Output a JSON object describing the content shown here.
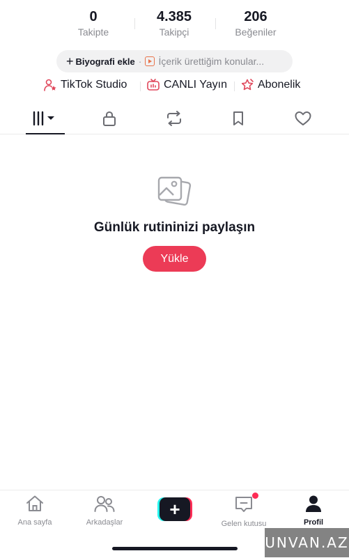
{
  "stats": [
    {
      "value": "0",
      "label": "Takipte"
    },
    {
      "value": "4.385",
      "label": "Takipçi"
    },
    {
      "value": "206",
      "label": "Beğeniler"
    }
  ],
  "bio_pill": {
    "add_label": "Biyografi ekle",
    "separator": "·",
    "topics_label": "İçerik ürettiğim konular..."
  },
  "links": [
    {
      "label": "TikTok Studio",
      "icon": "person-star-icon"
    },
    {
      "label": "CANLI Yayın",
      "icon": "live-tv-icon"
    },
    {
      "label": "Abonelik",
      "icon": "subscription-star-icon"
    }
  ],
  "tabs": [
    {
      "name": "videos",
      "icon": "grid-bars-icon",
      "active": true
    },
    {
      "name": "private",
      "icon": "lock-icon"
    },
    {
      "name": "reposts",
      "icon": "repost-icon"
    },
    {
      "name": "favorites",
      "icon": "bookmark-icon"
    },
    {
      "name": "liked",
      "icon": "heart-icon"
    }
  ],
  "empty_state": {
    "icon": "photos-icon",
    "title": "Günlük rutininizi paylaşın",
    "button_label": "Yükle"
  },
  "bottom_nav": [
    {
      "label": "Ana sayfa",
      "icon": "home-icon"
    },
    {
      "label": "Arkadaşlar",
      "icon": "friends-icon"
    },
    {
      "label": "",
      "icon": "create-icon"
    },
    {
      "label": "Gelen kutusu",
      "icon": "inbox-icon"
    },
    {
      "label": "Profil",
      "icon": "profile-icon",
      "active": true
    }
  ],
  "watermark": "UNVAN.AZ",
  "colors": {
    "accent": "#ec3b56",
    "text": "#161823",
    "muted": "#8a8b91",
    "notification": "#fe2c55"
  }
}
